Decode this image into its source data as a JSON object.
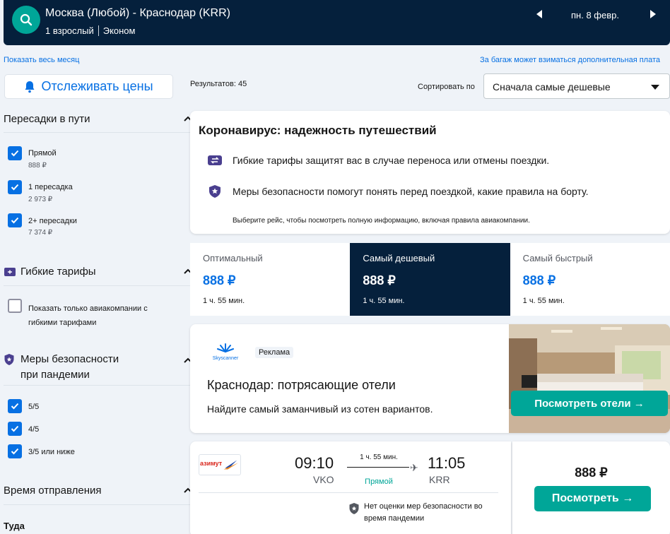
{
  "header": {
    "route": "Москва (Любой) - Краснодар (KRR)",
    "passengers": "1 взрослый",
    "cabin": "Эконом",
    "date": "пн. 8 февр."
  },
  "links": {
    "month": "Показать весь месяц",
    "baggage": "За багаж может взиматься дополнительная плата"
  },
  "sidebar": {
    "track_prices": "Отслеживать цены",
    "stops": {
      "title": "Пересадки в пути",
      "items": [
        {
          "label": "Прямой",
          "price": "888 ₽",
          "checked": true
        },
        {
          "label": "1 пересадка",
          "price": "2 973 ₽",
          "checked": true
        },
        {
          "label": "2+ пересадки",
          "price": "7 374 ₽",
          "checked": true
        }
      ]
    },
    "flexible": {
      "title": "Гибкие тарифы",
      "option": "Показать только авиакомпании с гибкими тарифами"
    },
    "safety": {
      "title": "Меры безопасности при пандемии",
      "items": [
        {
          "label": "5/5",
          "checked": true
        },
        {
          "label": "4/5",
          "checked": true
        },
        {
          "label": "3/5 или ниже",
          "checked": true
        }
      ]
    },
    "departure": {
      "title": "Время отправления",
      "sub": "Туда"
    }
  },
  "results": {
    "count": "Результатов: 45",
    "sort_label": "Сортировать по",
    "sort_value": "Сначала самые дешевые"
  },
  "covid": {
    "title": "Коронавирус: надежность путешествий",
    "row1": "Гибкие тарифы защитят вас в случае переноса или отмены поездки.",
    "row2": "Меры безопасности помогут понять перед поездкой, какие правила на борту.",
    "note": "Выберите рейс, чтобы посмотреть полную информацию, включая правила авиакомпании."
  },
  "tabs": [
    {
      "title": "Оптимальный",
      "price": "888 ₽",
      "duration": "1 ч. 55 мин."
    },
    {
      "title": "Самый дешевый",
      "price": "888 ₽",
      "duration": "1 ч. 55 мин."
    },
    {
      "title": "Самый быстрый",
      "price": "888 ₽",
      "duration": "1 ч. 55 мин."
    }
  ],
  "ad": {
    "logo_text": "Skyscanner",
    "badge": "Реклама",
    "title": "Краснодар: потрясающие отели",
    "desc": "Найдите самый заманчивый из сотен вариантов.",
    "button": "Посмотреть отели →"
  },
  "flight": {
    "airline_logo_text": "азимут",
    "dep_time": "09:10",
    "dep_airport": "VKO",
    "arr_time": "11:05",
    "arr_airport": "KRR",
    "duration": "1 ч. 55 мин.",
    "stops": "Прямой",
    "safety_note": "Нет оценки мер безопасности во время пандемии",
    "price": "888 ₽",
    "button": "Посмотреть →"
  },
  "colors": {
    "header_bg": "#05203c",
    "accent_blue": "#0770e3",
    "accent_green": "#00a698"
  }
}
